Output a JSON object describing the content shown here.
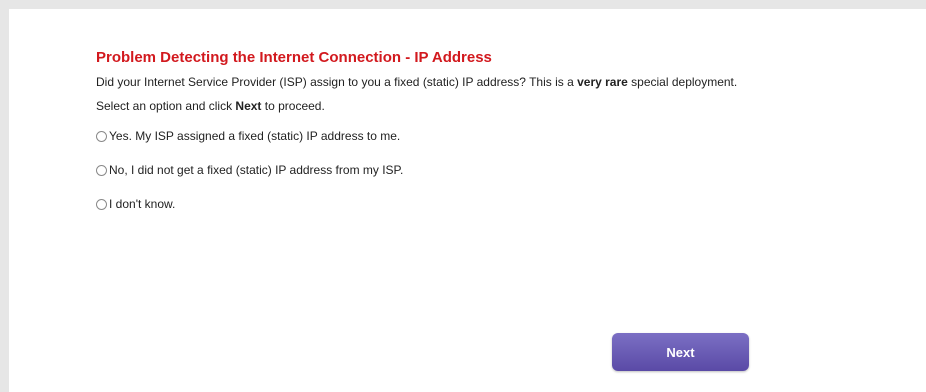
{
  "title": "Problem Detecting the Internet Connection - IP Address",
  "description": {
    "part1": "Did your Internet Service Provider (ISP) assign to you a fixed (static) IP address? This is a ",
    "bold": "very rare",
    "part2": " special deployment."
  },
  "instruction": {
    "part1": "Select an option and click ",
    "bold": "Next",
    "part2": " to proceed."
  },
  "options": [
    "Yes. My ISP assigned a fixed (static) IP address to me.",
    "No, I did not get a fixed (static) IP address from my ISP.",
    "I don't know."
  ],
  "next_button_label": "Next",
  "colors": {
    "title": "#d2191e",
    "button": "#6a5cb8",
    "frame": "#e6e6e6"
  }
}
